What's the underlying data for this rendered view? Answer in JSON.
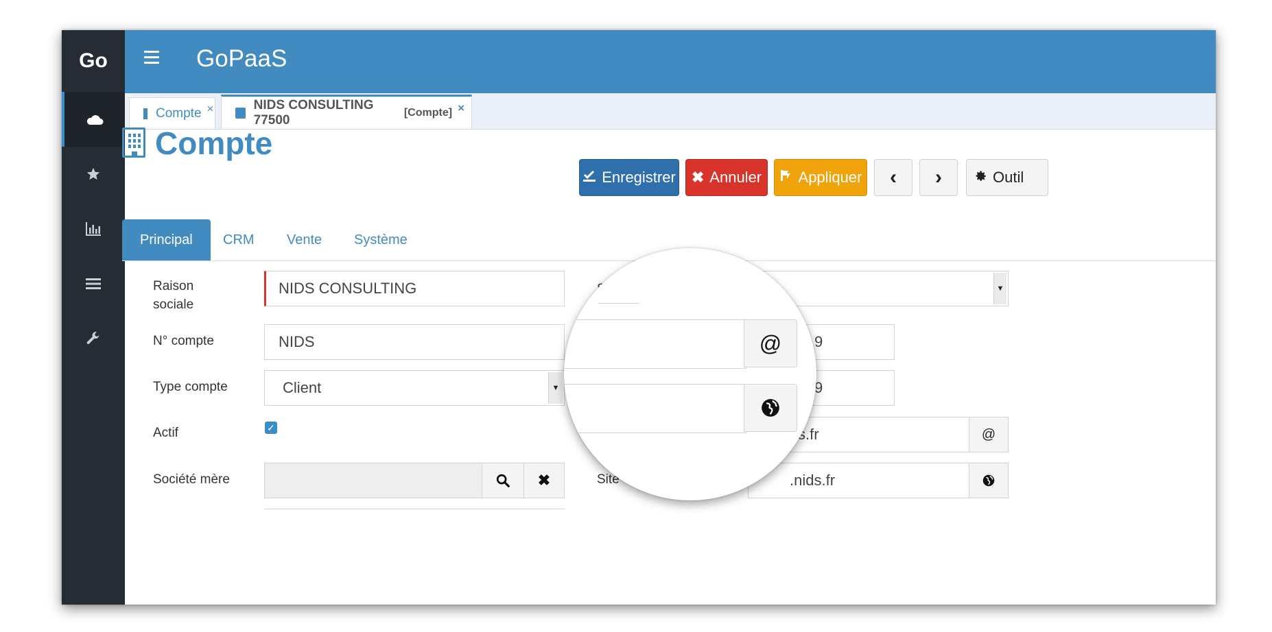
{
  "app": {
    "logo": "Go",
    "title": "GoPaaS"
  },
  "sidebar": {
    "items": [
      {
        "name": "cloud-icon"
      },
      {
        "name": "star-icon"
      },
      {
        "name": "bar-chart-icon"
      },
      {
        "name": "list-icon"
      },
      {
        "name": "wrench-icon"
      }
    ]
  },
  "doc_tabs": [
    {
      "label": "Compte",
      "suffix": "",
      "close": "×"
    },
    {
      "label": "NIDS CONSULTING 77500",
      "suffix": "[Compte]",
      "close": "×"
    }
  ],
  "page": {
    "title": "Compte"
  },
  "toolbar": {
    "save": "Enregistrer",
    "cancel": "Annuler",
    "apply": "Appliquer",
    "prev": "‹",
    "next": "›",
    "tools": "Outil"
  },
  "colors": {
    "primary": "#428bc1",
    "sidebar": "#262c33",
    "save": "#2f6fab",
    "cancel": "#d9342b",
    "apply": "#f0a30a"
  },
  "form_tabs": [
    "Principal",
    "CRM",
    "Vente",
    "Système"
  ],
  "form": {
    "raison_sociale": {
      "label_line1": "Raison",
      "label_line2": "sociale",
      "value": "NIDS CONSULTING"
    },
    "numero_compte": {
      "label": "N° compte",
      "value": "NIDS"
    },
    "type_compte": {
      "label": "Type compte",
      "value": "Client"
    },
    "actif": {
      "label": "Actif",
      "checked": true,
      "mark": "✓"
    },
    "societe_mere": {
      "label": "Société mère",
      "value": ""
    },
    "right_col": {
      "label_s": "S",
      "phone1_partial": "9",
      "phone2_partial": "9",
      "email_partial": "s.fr",
      "site_label": "Site",
      "site_partial": ".nids.fr"
    }
  },
  "magnifier": {
    "at_icon": "@",
    "globe_icon": "globe-icon"
  }
}
